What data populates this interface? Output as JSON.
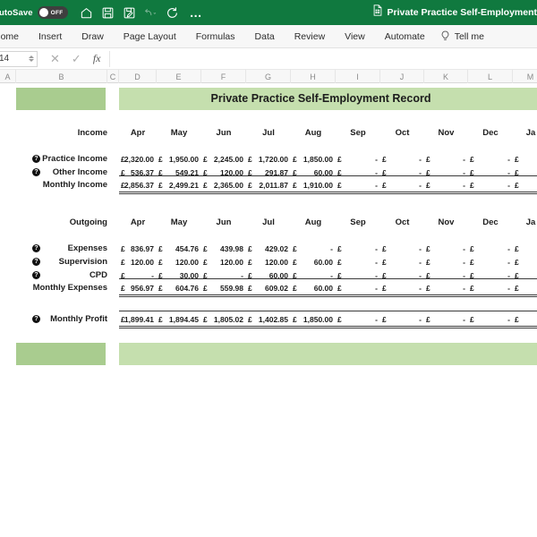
{
  "titlebar": {
    "autosave_label": "AutoSave",
    "autosave_state": "OFF",
    "icons": [
      "home-icon",
      "save-icon",
      "save-as-icon",
      "undo-icon",
      "redo-icon",
      "more-commands-icon"
    ],
    "more_label": "…",
    "document_title": "Private Practice Self-Employment",
    "brand_color": "#10793F"
  },
  "ribbon": {
    "tabs": [
      {
        "label": "Home"
      },
      {
        "label": "Insert"
      },
      {
        "label": "Draw"
      },
      {
        "label": "Page Layout"
      },
      {
        "label": "Formulas"
      },
      {
        "label": "Data"
      },
      {
        "label": "Review"
      },
      {
        "label": "View"
      },
      {
        "label": "Automate"
      }
    ],
    "tell_me_label": "Tell me"
  },
  "formula_bar": {
    "name_box_value": "14",
    "cancel_label": "✕",
    "confirm_label": "✓",
    "fx_label": "fx",
    "formula_value": ""
  },
  "grid": {
    "column_headers": [
      "A",
      "B",
      "C",
      "D",
      "E",
      "F",
      "G",
      "H",
      "I",
      "J",
      "K",
      "L",
      "M"
    ]
  },
  "sheet": {
    "title": "Private Practice Self-Employment Record",
    "band_color_dark": "#a9cc8f",
    "band_color_light": "#c5dfae",
    "currency_symbol": "£",
    "blank_marker": "-",
    "months": [
      "Apr",
      "May",
      "Jun",
      "Jul",
      "Aug",
      "Sep",
      "Oct",
      "Nov",
      "Dec",
      "Ja"
    ],
    "income": {
      "section_label": "Income",
      "rows": [
        {
          "label": "Practice Income",
          "has_help": true,
          "values": [
            "2,320.00",
            "1,950.00",
            "2,245.00",
            "1,720.00",
            "1,850.00",
            "-",
            "-",
            "-",
            "-",
            ""
          ]
        },
        {
          "label": "Other Income",
          "has_help": true,
          "values": [
            "536.37",
            "549.21",
            "120.00",
            "291.87",
            "60.00",
            "-",
            "-",
            "-",
            "-",
            ""
          ]
        }
      ],
      "total": {
        "label": "Monthly  Income",
        "has_help": false,
        "values": [
          "2,856.37",
          "2,499.21",
          "2,365.00",
          "2,011.87",
          "1,910.00",
          "-",
          "-",
          "-",
          "-",
          ""
        ]
      }
    },
    "outgoing": {
      "section_label": "Outgoing",
      "rows": [
        {
          "label": "Expenses",
          "has_help": true,
          "values": [
            "836.97",
            "454.76",
            "439.98",
            "429.02",
            "-",
            "-",
            "-",
            "-",
            "-",
            ""
          ]
        },
        {
          "label": "Supervision",
          "has_help": true,
          "values": [
            "120.00",
            "120.00",
            "120.00",
            "120.00",
            "60.00",
            "-",
            "-",
            "-",
            "-",
            ""
          ]
        },
        {
          "label": "CPD",
          "has_help": true,
          "values": [
            "-",
            "30.00",
            "-",
            "60.00",
            "-",
            "-",
            "-",
            "-",
            "-",
            ""
          ]
        }
      ],
      "total": {
        "label": "Monthly Expenses",
        "has_help": false,
        "values": [
          "956.97",
          "604.76",
          "559.98",
          "609.02",
          "60.00",
          "-",
          "-",
          "-",
          "-",
          ""
        ]
      }
    },
    "profit": {
      "label": "Monthly Profit",
      "has_help": true,
      "values": [
        "1,899.41",
        "1,894.45",
        "1,805.02",
        "1,402.85",
        "1,850.00",
        "-",
        "-",
        "-",
        "-",
        ""
      ]
    }
  }
}
